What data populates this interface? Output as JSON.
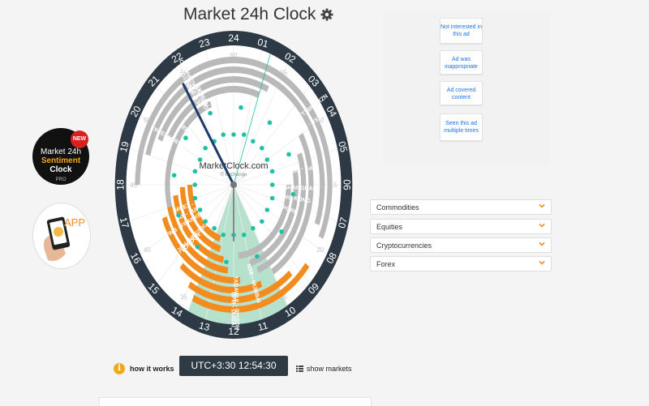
{
  "header": {
    "title": "Market 24h Clock"
  },
  "clock": {
    "hours": [
      "24",
      "01",
      "02",
      "03",
      "04",
      "05",
      "06",
      "07",
      "08",
      "09",
      "10",
      "11",
      "12",
      "13",
      "14",
      "15",
      "16",
      "17",
      "18",
      "19",
      "20",
      "21",
      "22",
      "23"
    ],
    "minute_marks": [
      "60",
      "05",
      "10",
      "15",
      "20",
      "25",
      "30",
      "35",
      "40",
      "45",
      "50",
      "55"
    ],
    "center_brand": "MarketClock.com",
    "center_sub": "© Exchange",
    "markets": [
      "NEW YORK",
      "TORONTO",
      "SÃO PAULO",
      "CHICAGO",
      "NYSE - NASDAQ",
      "NYSE",
      "BMAFBOVESPA",
      "ASX - SYDNEY",
      "NZX - WELLINGTON",
      "JPX - TOKYO",
      "SSE - SHANGHAI",
      "HKEX - HONG KONG",
      "SGX - SINGAPORE",
      "NSE - MUMBAI",
      "TADAWUL - RIYADH",
      "DFM - DUBAI",
      "LSE - LONDON",
      "JSE - JOHANNESBURG",
      "FWB - FRANKFURT",
      "SIX - ZURICH",
      "MOEX - MOSCOW"
    ],
    "colors": {
      "ring": "#2d3a45",
      "closed": "#b9b9b9",
      "open": "#f28c1e",
      "sector": "#a8dcc4",
      "dots": "#1fc1a5",
      "hand": "#1c3b6b"
    }
  },
  "promos": {
    "sentiment": {
      "badge": "NEW",
      "line1": "Market 24h",
      "line2": "Sentiment",
      "line3": "Clock",
      "line4": "PRO"
    },
    "app": {
      "label": "APP"
    }
  },
  "ads": {
    "buttons": [
      "Not interested in this ad",
      "Ad was inappropriate",
      "Ad covered content",
      "Seen this ad multiple times"
    ]
  },
  "categories": [
    "Commodities",
    "Equities",
    "Cryptocurrencies",
    "Forex"
  ],
  "footer": {
    "how_it_works": "how it works",
    "time": "UTC+3:30 12:54:30",
    "show_markets": "show markets"
  }
}
